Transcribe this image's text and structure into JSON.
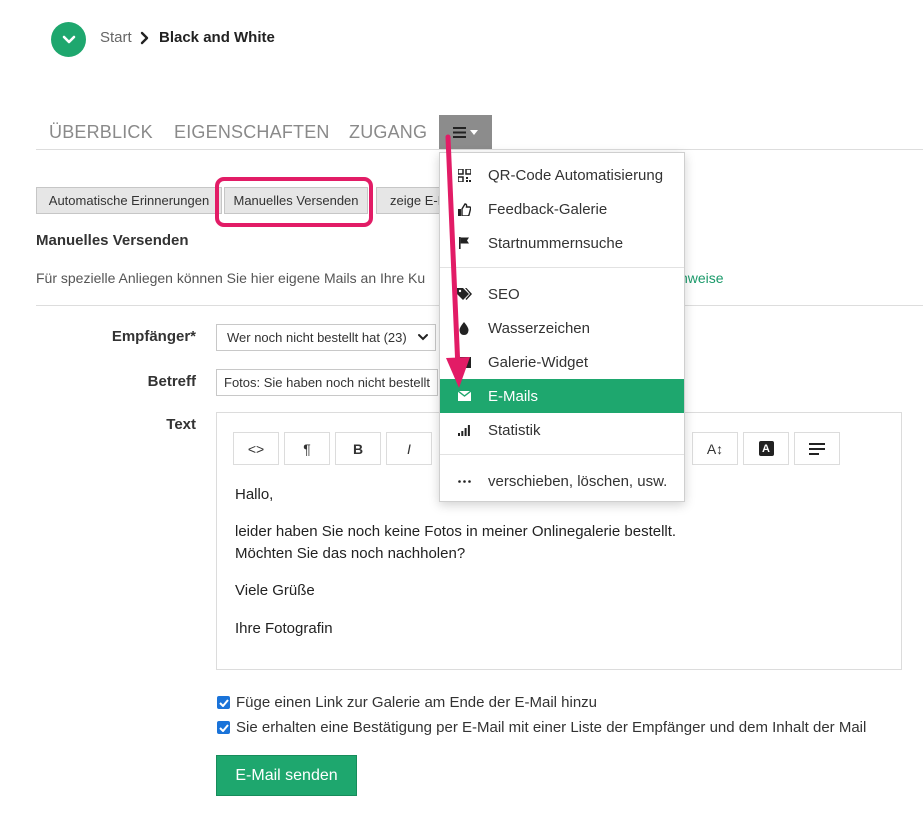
{
  "breadcrumb": {
    "start": "Start",
    "separator": "›",
    "current": "Black and White"
  },
  "tabs": [
    {
      "label": "ÜBERBLICK"
    },
    {
      "label": "EIGENSCHAFTEN"
    },
    {
      "label": "ZUGANG"
    }
  ],
  "subtabs": [
    {
      "label": "Automatische Erinnerungen"
    },
    {
      "label": "Manuelles Versenden"
    },
    {
      "label": "zeige E-M"
    }
  ],
  "section": {
    "title": "Manuelles Versenden",
    "description": "Für spezielle Anliegen können Sie hier eigene Mails an Ihre Ku",
    "link_fragment": "nweise"
  },
  "form": {
    "recipient_label": "Empfänger*",
    "recipient_value": "Wer noch nicht bestellt hat (23)",
    "subject_label": "Betreff",
    "subject_value": "Fotos: Sie haben noch nicht bestellt",
    "text_label": "Text"
  },
  "toolbar": {
    "code": "<>",
    "paragraph": "¶",
    "bold": "B",
    "italic": "I",
    "font_size": "A↕",
    "color": "A"
  },
  "editor": {
    "lines": [
      "Hallo,",
      "leider haben Sie noch keine Fotos in meiner Onlinegalerie bestellt.",
      "Möchten Sie das noch nachholen?",
      "Viele Grüße",
      "Ihre Fotografin"
    ]
  },
  "checkboxes": [
    {
      "label": "Füge einen Link zur Galerie am Ende der E-Mail hinzu",
      "checked": true
    },
    {
      "label": "Sie erhalten eine Bestätigung per E-Mail mit einer Liste der Empfänger und dem Inhalt der Mail",
      "checked": true
    }
  ],
  "send_button": "E-Mail senden",
  "dropdown": {
    "items": [
      {
        "label": "QR-Code Automatisierung",
        "icon": "qr-code-icon"
      },
      {
        "label": "Feedback-Galerie",
        "icon": "thumbs-up-icon"
      },
      {
        "label": "Startnummernsuche",
        "icon": "flag-icon"
      },
      {
        "label": "SEO",
        "icon": "tags-icon"
      },
      {
        "label": "Wasserzeichen",
        "icon": "drop-icon"
      },
      {
        "label": "Galerie-Widget",
        "icon": "widget-icon"
      },
      {
        "label": "E-Mails",
        "icon": "envelope-icon",
        "active": true
      },
      {
        "label": "Statistik",
        "icon": "bar-chart-icon"
      },
      {
        "label": "verschieben, löschen, usw.",
        "icon": "ellipsis-icon"
      }
    ]
  },
  "colors": {
    "brand_green": "#1ea76e",
    "highlight_pink": "#e21c66",
    "checkbox_blue": "#1a73d9"
  }
}
